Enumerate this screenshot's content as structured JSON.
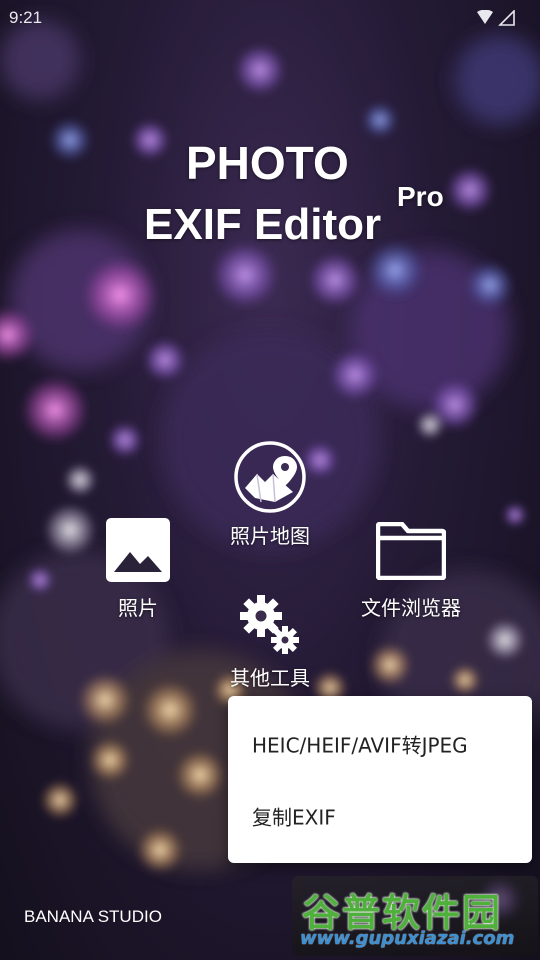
{
  "status_bar": {
    "time": "9:21",
    "icons": [
      "wifi-icon",
      "signal-icon"
    ]
  },
  "app": {
    "title_line1": "PHOTO",
    "title_line2": "EXIF Editor",
    "title_superscript": "Pro"
  },
  "menu": {
    "map_label": "照片地图",
    "photos_label": "照片",
    "browser_label": "文件浏览器",
    "tools_label": "其他工具"
  },
  "popup": {
    "items": [
      "HEIC/HEIF/AVIF转JPEG",
      "复制EXIF"
    ]
  },
  "footer": {
    "studio": "BANANA STUDIO"
  },
  "watermark": {
    "text": "谷普软件园",
    "url": "www.gupuxiazai.com"
  },
  "colors": {
    "background_dark": "#1a1426",
    "bokeh_purple": "#9a6fd6",
    "bokeh_pink": "#e47be0",
    "popup_bg": "#ffffff",
    "watermark_green": "#4fb13c",
    "watermark_blue": "#3c8fd0"
  }
}
